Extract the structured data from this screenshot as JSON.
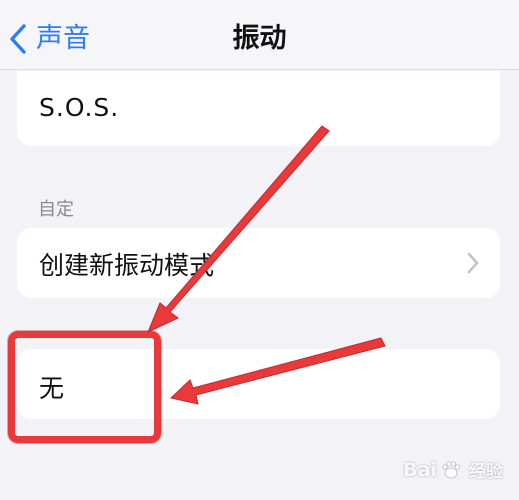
{
  "navbar": {
    "back_label": "声音",
    "title": "振动"
  },
  "sos_row": {
    "label": "S.O.S."
  },
  "custom_section": {
    "header": "自定",
    "create_label": "创建新振动模式"
  },
  "none_row": {
    "label": "无"
  },
  "watermark": {
    "brand_left": "Bai",
    "brand_right": "经验"
  },
  "colors": {
    "accent": "#2d7cf6",
    "annotation_red": "#e8393b",
    "background": "#f2f2f7"
  }
}
